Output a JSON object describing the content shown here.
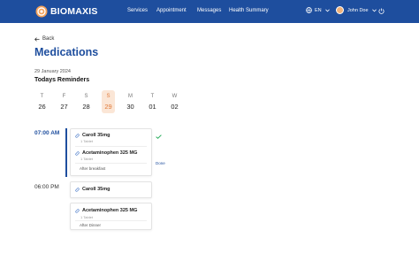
{
  "brand": {
    "name": "BIOMAXIS"
  },
  "nav": {
    "items": [
      "Services",
      "Appointment",
      "Messages",
      "Health Summary"
    ]
  },
  "language": {
    "code": "EN"
  },
  "user": {
    "name": "John Doe"
  },
  "page": {
    "back_label": "Back",
    "title": "Medications",
    "date": "29 January 2024",
    "subtitle": "Todays Reminders"
  },
  "week": [
    {
      "label": "T",
      "num": "26",
      "selected": false
    },
    {
      "label": "F",
      "num": "27",
      "selected": false
    },
    {
      "label": "S",
      "num": "28",
      "selected": false
    },
    {
      "label": "S",
      "num": "29",
      "selected": true
    },
    {
      "label": "M",
      "num": "30",
      "selected": false
    },
    {
      "label": "T",
      "num": "01",
      "selected": false
    },
    {
      "label": "W",
      "num": "02",
      "selected": false
    }
  ],
  "schedule": [
    {
      "time": "07:00 AM",
      "meds": [
        {
          "name": "Caroll 35mg",
          "qty": "1 Tablet",
          "note": ""
        },
        {
          "name": "Acetaminophen 325 MG",
          "qty": "1 Tablet",
          "note": "After breakfast"
        }
      ],
      "status": "Done"
    },
    {
      "time": "06:00 PM",
      "meds": [
        {
          "name": "Caroll 35mg",
          "qty": "",
          "note": ""
        },
        {
          "name": "Acetaminophen 325 MG",
          "qty": "1 Tablet",
          "note": "After Dinner"
        }
      ]
    }
  ],
  "colors": {
    "primary": "#1e4e9e",
    "accent": "#e07a3a",
    "selected_bg": "#fbe6d6"
  }
}
